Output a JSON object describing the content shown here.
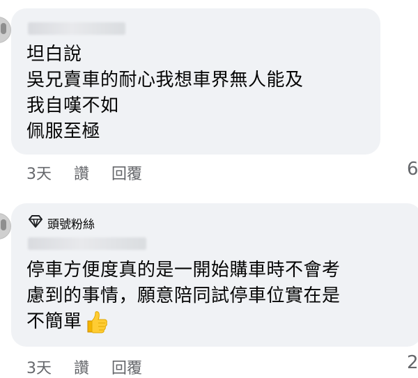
{
  "comments": [
    {
      "text_lines": [
        "坦白說",
        "吳兄賣車的耐心我想車界無人能及",
        "我自嘆不如",
        "佩服至極"
      ],
      "time": "3天",
      "like_label": "讚",
      "reply_label": "回覆",
      "reaction_count": "6"
    },
    {
      "badge_label": "頭號粉絲",
      "badge_icon": "diamond-icon",
      "text_lines": [
        "停車方便度真的是一開始購車時不會考",
        "慮到的事情，願意陪同試停車位實在是",
        "不簡單"
      ],
      "emoji": "thumbs-up-emoji",
      "time": "3天",
      "like_label": "讚",
      "reply_label": "回覆",
      "reaction_count": "2"
    }
  ],
  "colors": {
    "bubble_bg": "#f0f2f5",
    "meta_text": "#65676b",
    "text": "#050505"
  }
}
